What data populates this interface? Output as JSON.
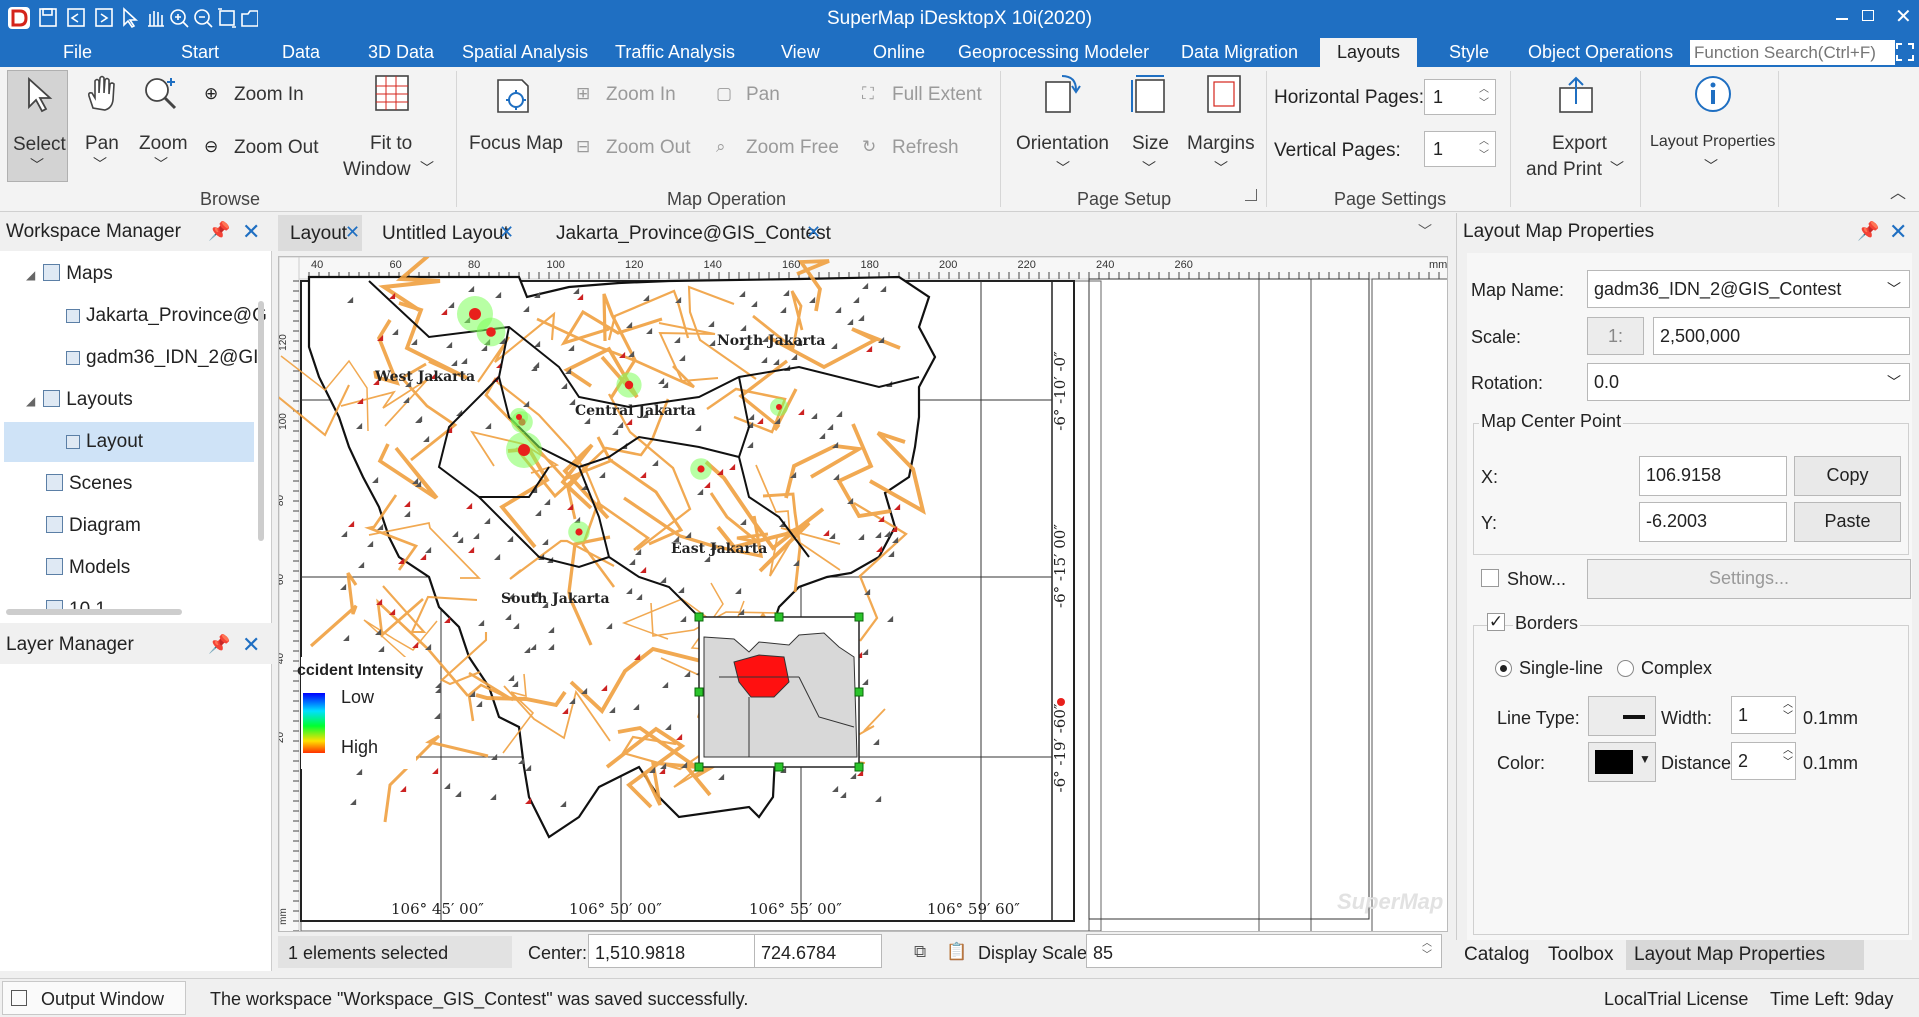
{
  "app": {
    "title": "SuperMap iDesktopX 10i(2020)"
  },
  "menu": {
    "items": [
      "File",
      "Start",
      "Data",
      "3D Data",
      "Spatial Analysis",
      "Traffic Analysis",
      "View",
      "Online",
      "Geoprocessing Modeler",
      "Data Migration",
      "Layouts",
      "Style",
      "Object Operations"
    ],
    "active": "Layouts",
    "search_placeholder": "Function Search(Ctrl+F)"
  },
  "ribbon": {
    "browse": {
      "select": "Select",
      "pan": "Pan",
      "zoom": "Zoom",
      "zoom_in": "Zoom In",
      "zoom_out": "Zoom Out",
      "fit_to": "Fit to",
      "window": "Window",
      "group": "Browse"
    },
    "map_operation": {
      "focus_map": "Focus Map",
      "zoom_in": "Zoom In",
      "zoom_out": "Zoom Out",
      "pan": "Pan",
      "zoom_free": "Zoom Free",
      "full_extent": "Full Extent",
      "refresh": "Refresh",
      "group": "Map Operation"
    },
    "page_setup": {
      "orientation": "Orientation",
      "size": "Size",
      "margins": "Margins",
      "group": "Page Setup"
    },
    "page_settings": {
      "horizontal_pages_label": "Horizontal Pages:",
      "horizontal_pages": "1",
      "vertical_pages_label": "Vertical Pages:",
      "vertical_pages": "1",
      "group": "Page Settings"
    },
    "export": {
      "line1": "Export",
      "line2": "and Print"
    },
    "layout_properties": "Layout Properties"
  },
  "workspace": {
    "title": "Workspace Manager",
    "tree": {
      "maps": "Maps",
      "map1": "Jakarta_Province@G",
      "map2": "gadm36_IDN_2@GI",
      "layouts": "Layouts",
      "layout": "Layout",
      "scenes": "Scenes",
      "diagram": "Diagram",
      "models": "Models",
      "cut": "10 1"
    }
  },
  "layer_manager": {
    "title": "Layer Manager"
  },
  "doc_tabs": [
    "Layout",
    "Untitled Layout",
    "Jakarta_Province@GIS_Contest"
  ],
  "map": {
    "ruler_top": [
      "40",
      "60",
      "80",
      "100",
      "120",
      "140",
      "160",
      "180",
      "200",
      "220",
      "240",
      "260",
      "mm"
    ],
    "ruler_left": [
      "120",
      "100",
      "80",
      "60",
      "40",
      "20",
      "mm"
    ],
    "regions": [
      "North Jakarta",
      "West Jakarta",
      "Central Jakarta",
      "East Jakarta",
      "South Jakarta"
    ],
    "lon_ticks": [
      "106° 45′ 00″",
      "106° 50′ 00″",
      "106° 55′ 00″",
      "106° 59′ 60″"
    ],
    "lat_ticks": [
      "-6° -10′ -0″",
      "-6° -15′ 00″",
      "-6° -19′ -60″"
    ],
    "legend": {
      "title": "ccident Intensity",
      "low": "Low",
      "high": "High"
    },
    "watermark": "SuperMap"
  },
  "status": {
    "selected": "1 elements selected",
    "center_label": "Center:",
    "center_x": "1,510.9818",
    "center_y": "724.6784",
    "display_scale_label": "Display Scale:",
    "display_scale": "85"
  },
  "properties": {
    "title": "Layout Map Properties",
    "map_name_label": "Map Name:",
    "map_name": "gadm36_IDN_2@GIS_Contest",
    "scale_label": "Scale:",
    "scale_prefix": "1:",
    "scale": "2,500,000",
    "rotation_label": "Rotation:",
    "rotation": "0.0",
    "center_group": "Map Center Point",
    "x_label": "X:",
    "x": "106.9158",
    "y_label": "Y:",
    "y": "-6.2003",
    "copy": "Copy",
    "paste": "Paste",
    "show": "Show...",
    "settings": "Settings...",
    "borders": "Borders",
    "single_line": "Single-line",
    "complex": "Complex",
    "line_type_label": "Line Type:",
    "width_label": "Width:",
    "width": "1",
    "unit": "0.1mm",
    "color_label": "Color:",
    "distance_label": "Distance:",
    "distance": "2",
    "unit2": "0.1mm"
  },
  "bottom_tabs": [
    "Catalog",
    "Toolbox",
    "Layout Map Properties"
  ],
  "footer": {
    "output_window": "Output Window",
    "message": "The workspace \"Workspace_GIS_Contest\" was saved successfully.",
    "license": "LocalTrial License",
    "time_left": "Time Left: 9day"
  },
  "colors": {
    "accent": "#1f6fc2",
    "selection": "#cfe3f7",
    "road": "#f0a040",
    "hotspot": "#e8201c"
  }
}
